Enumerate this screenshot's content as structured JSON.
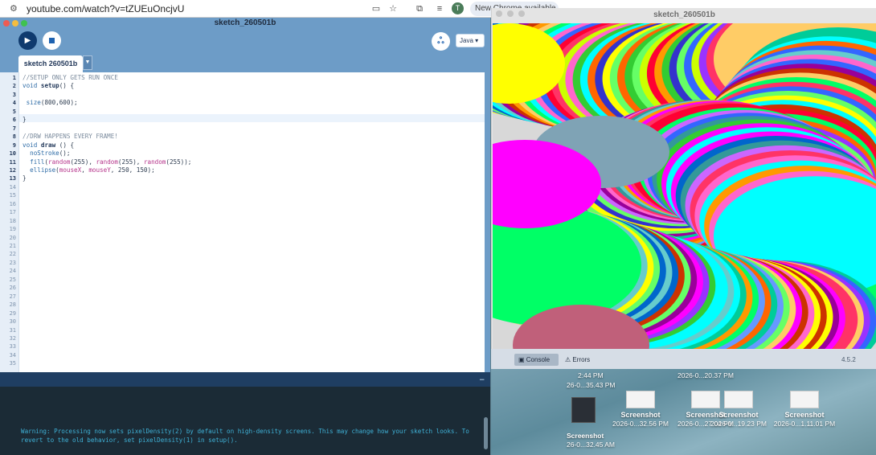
{
  "browser": {
    "url": "youtube.com/watch?v=tZUEuOncjvU",
    "avatar_letter": "T",
    "update_label": "New Chrome available"
  },
  "ide": {
    "window_title": "sketch_260501b",
    "tab_label": "sketch 260501b",
    "mode_label": "Java ▾",
    "line_numbers": [
      "1",
      "2",
      "3",
      "4",
      "5",
      "6",
      "7",
      "8",
      "9",
      "10",
      "11",
      "12",
      "13",
      "14",
      "15",
      "16",
      "17",
      "18",
      "19",
      "20",
      "21",
      "22",
      "23",
      "24",
      "25",
      "26",
      "27",
      "28",
      "29",
      "30",
      "31",
      "32",
      "33",
      "34",
      "35"
    ],
    "code": [
      "//SETUP ONLY GETS RUN ONCE",
      "void setup() {",
      "",
      " size(800,600);",
      "",
      "}",
      "",
      "//DRW HAPPENS EVERY FRAME!",
      "void draw () {",
      "  noStroke();",
      "  fill(random(255), random(255), random(255));",
      "  ellipse(mouseX, mouseY, 250, 150);",
      "}"
    ],
    "console_message": "Warning: Processing now sets pixelDensity(2) by default on high-density screens. This may change how your sketch looks. To revert to the old behavior, set pixelDensity(1) in setup()."
  },
  "sketch_window": {
    "title": "sketch_260501b"
  },
  "console_panel": {
    "console_tab": "Console",
    "errors_tab": "Errors",
    "version": "4.5.2"
  },
  "desktop": {
    "top_labels": [
      "2:44 PM",
      "2026-0...20.37 PM"
    ],
    "files": [
      {
        "name": "Screenshot",
        "date": "2026-0...32.56 PM"
      },
      {
        "name": "Screenshot",
        "date": "2026-0...27.04 PM"
      },
      {
        "name": "Screenshot",
        "date": "2026-0...19.23 PM"
      },
      {
        "name": "Screenshot",
        "date": "2026-0...1.11.01 PM"
      }
    ],
    "left_labels": [
      "26-0...35.43 PM",
      "Screenshot",
      "26-0...32.45 AM"
    ]
  },
  "colors": {
    "ide_blue": "#6d9cc7",
    "run_button": "#0f3a6e",
    "console_bg": "#1b2b36",
    "console_text": "#3fb1d6"
  }
}
